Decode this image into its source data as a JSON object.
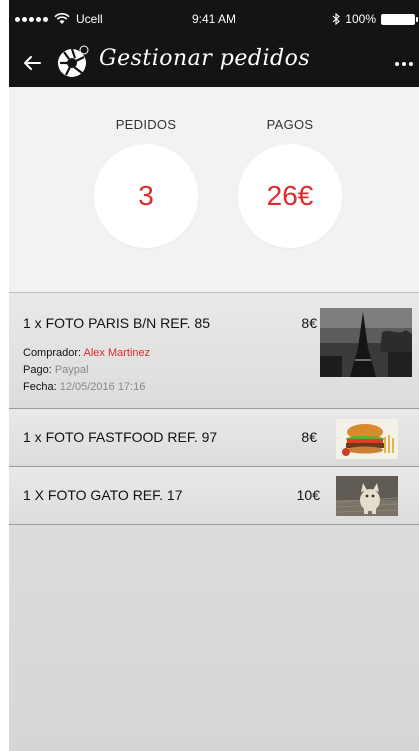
{
  "status_bar": {
    "carrier": "Ucell",
    "time": "9:41 AM",
    "battery": "100%"
  },
  "header": {
    "title": "Gestionar pedidos"
  },
  "summary": {
    "pedidos_label": "PEDIDOS",
    "pedidos_value": "3",
    "pagos_label": "PAGOS",
    "pagos_value": "26€"
  },
  "orders": [
    {
      "title": "1 x FOTO PARIS B/N REF. 85",
      "price": "8€",
      "buyer_label": "Comprador:",
      "buyer": "Alex Martinez",
      "payment_label": "Pago:",
      "payment": "Paypal",
      "date_label": "Fecha:",
      "date": "12/05/2016 17:16"
    },
    {
      "title": "1 x FOTO FASTFOOD REF. 97",
      "price": "8€"
    },
    {
      "title": "1 X FOTO GATO REF. 17",
      "price": "10€"
    }
  ],
  "colors": {
    "accent": "#e22a2a",
    "header_bg": "#141316",
    "summary_bg": "#f2f2f2"
  }
}
